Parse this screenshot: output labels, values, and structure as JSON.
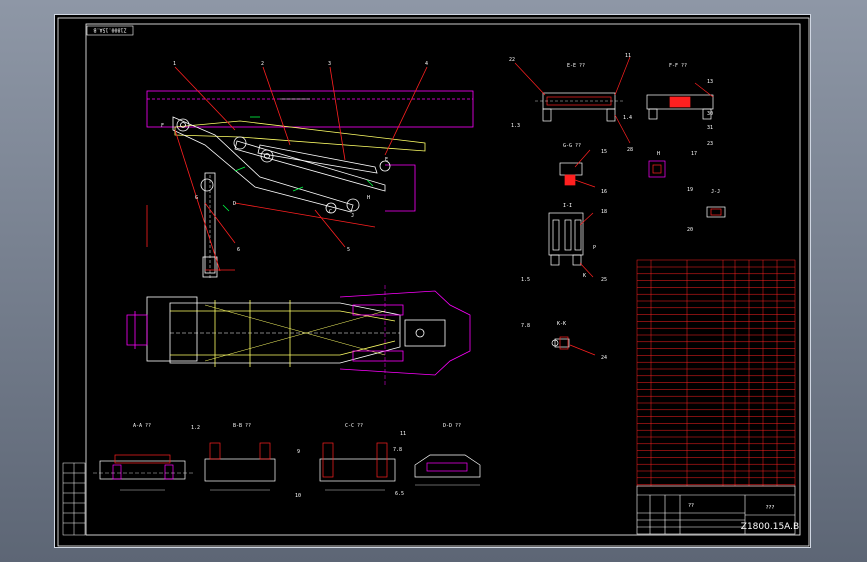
{
  "drawing": {
    "number_top": "Z1800.15A.B",
    "number_bottom": "Z1800.15A.B",
    "title_block_top": "???",
    "title_block_mid": "??",
    "colors": {
      "sheet_bg": "#000000",
      "frame": "#ffffff",
      "red": "#ff2020",
      "magenta": "#ff00ff",
      "yellow": "#ffff66",
      "green": "#00ff44",
      "cyan": "#00e0ff"
    }
  },
  "part_callouts": [
    "1",
    "2",
    "3",
    "4",
    "5",
    "6"
  ],
  "section_views": [
    {
      "title": "A-A ??",
      "callouts": [
        "1.2"
      ]
    },
    {
      "title": "B-B ??",
      "callouts": [
        "9",
        "10"
      ]
    },
    {
      "title": "C-C ??",
      "callouts": []
    },
    {
      "title": "D-D ??",
      "callouts": [
        "11",
        "7.8",
        "6.5"
      ]
    },
    {
      "title": "E-E ??",
      "callouts": [
        "22",
        "11",
        "1.3",
        "28"
      ]
    },
    {
      "title": "F-F ??",
      "callouts": [
        "13",
        "1.4",
        "30",
        "31",
        "23"
      ]
    },
    {
      "title": "G-G ??",
      "callouts": [
        "15",
        "16"
      ]
    },
    {
      "title": "H",
      "callouts": [
        "17"
      ]
    },
    {
      "title": "I-I",
      "callouts": [
        "18",
        "1.5",
        "25"
      ]
    },
    {
      "title": "J-J",
      "callouts": [
        "19",
        "20"
      ]
    },
    {
      "title": "K-K",
      "callouts": [
        "7.8",
        "24"
      ]
    }
  ],
  "section_letters": [
    "F",
    "G",
    "H",
    "D",
    "E",
    "C",
    "J",
    "K",
    "P"
  ]
}
